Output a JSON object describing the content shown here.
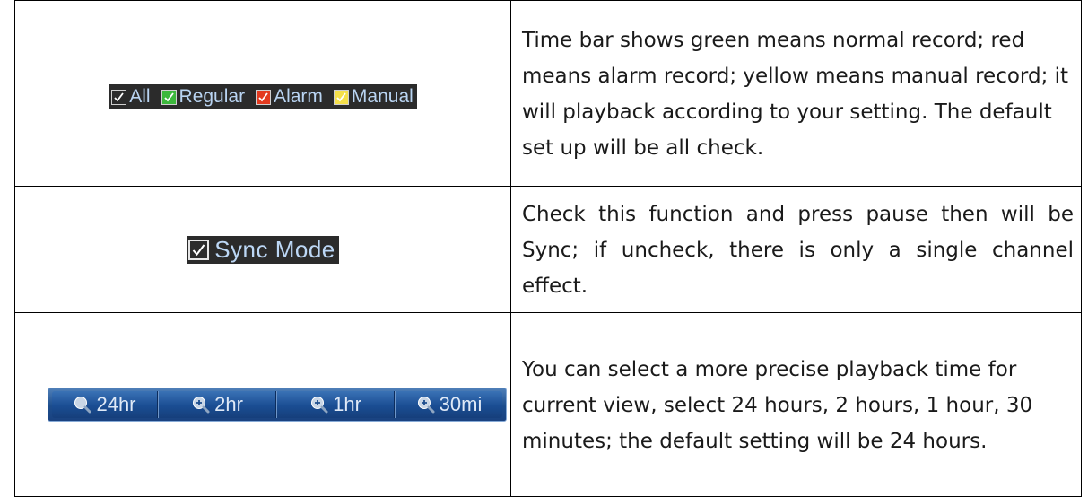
{
  "row1": {
    "filters": [
      {
        "label": "All",
        "color": "#2b2b2b",
        "icon": "checkbox-checked-icon"
      },
      {
        "label": "Regular",
        "color": "#3cb83c",
        "icon": "checkbox-checked-icon"
      },
      {
        "label": "Alarm",
        "color": "#e33a1f",
        "icon": "checkbox-checked-icon"
      },
      {
        "label": "Manual",
        "color": "#f5e04a",
        "icon": "checkbox-checked-icon"
      }
    ],
    "description": "Time bar shows green means normal record; red means alarm record; yellow means manual record; it will playback according to your setting. The default set up will be all check."
  },
  "row2": {
    "sync_label": "Sync Mode",
    "description": "Check this function and press pause then will be Sync; if uncheck, there is only a single channel effect."
  },
  "row3": {
    "buttons": [
      {
        "label": "24hr",
        "icon": "zoom-icon"
      },
      {
        "label": "2hr",
        "icon": "zoom-in-icon"
      },
      {
        "label": "1hr",
        "icon": "zoom-in-icon"
      },
      {
        "label": "30mi",
        "icon": "zoom-in-icon"
      }
    ],
    "description": "You can select a more precise playback time for current view, select 24 hours, 2 hours, 1 hour, 30 minutes; the default setting will be 24 hours."
  },
  "colors": {
    "ui_dark_bg": "#2b2b2b",
    "ui_text_blue": "#b9d4f2",
    "zoom_button_blue": "#1c4d8d"
  }
}
